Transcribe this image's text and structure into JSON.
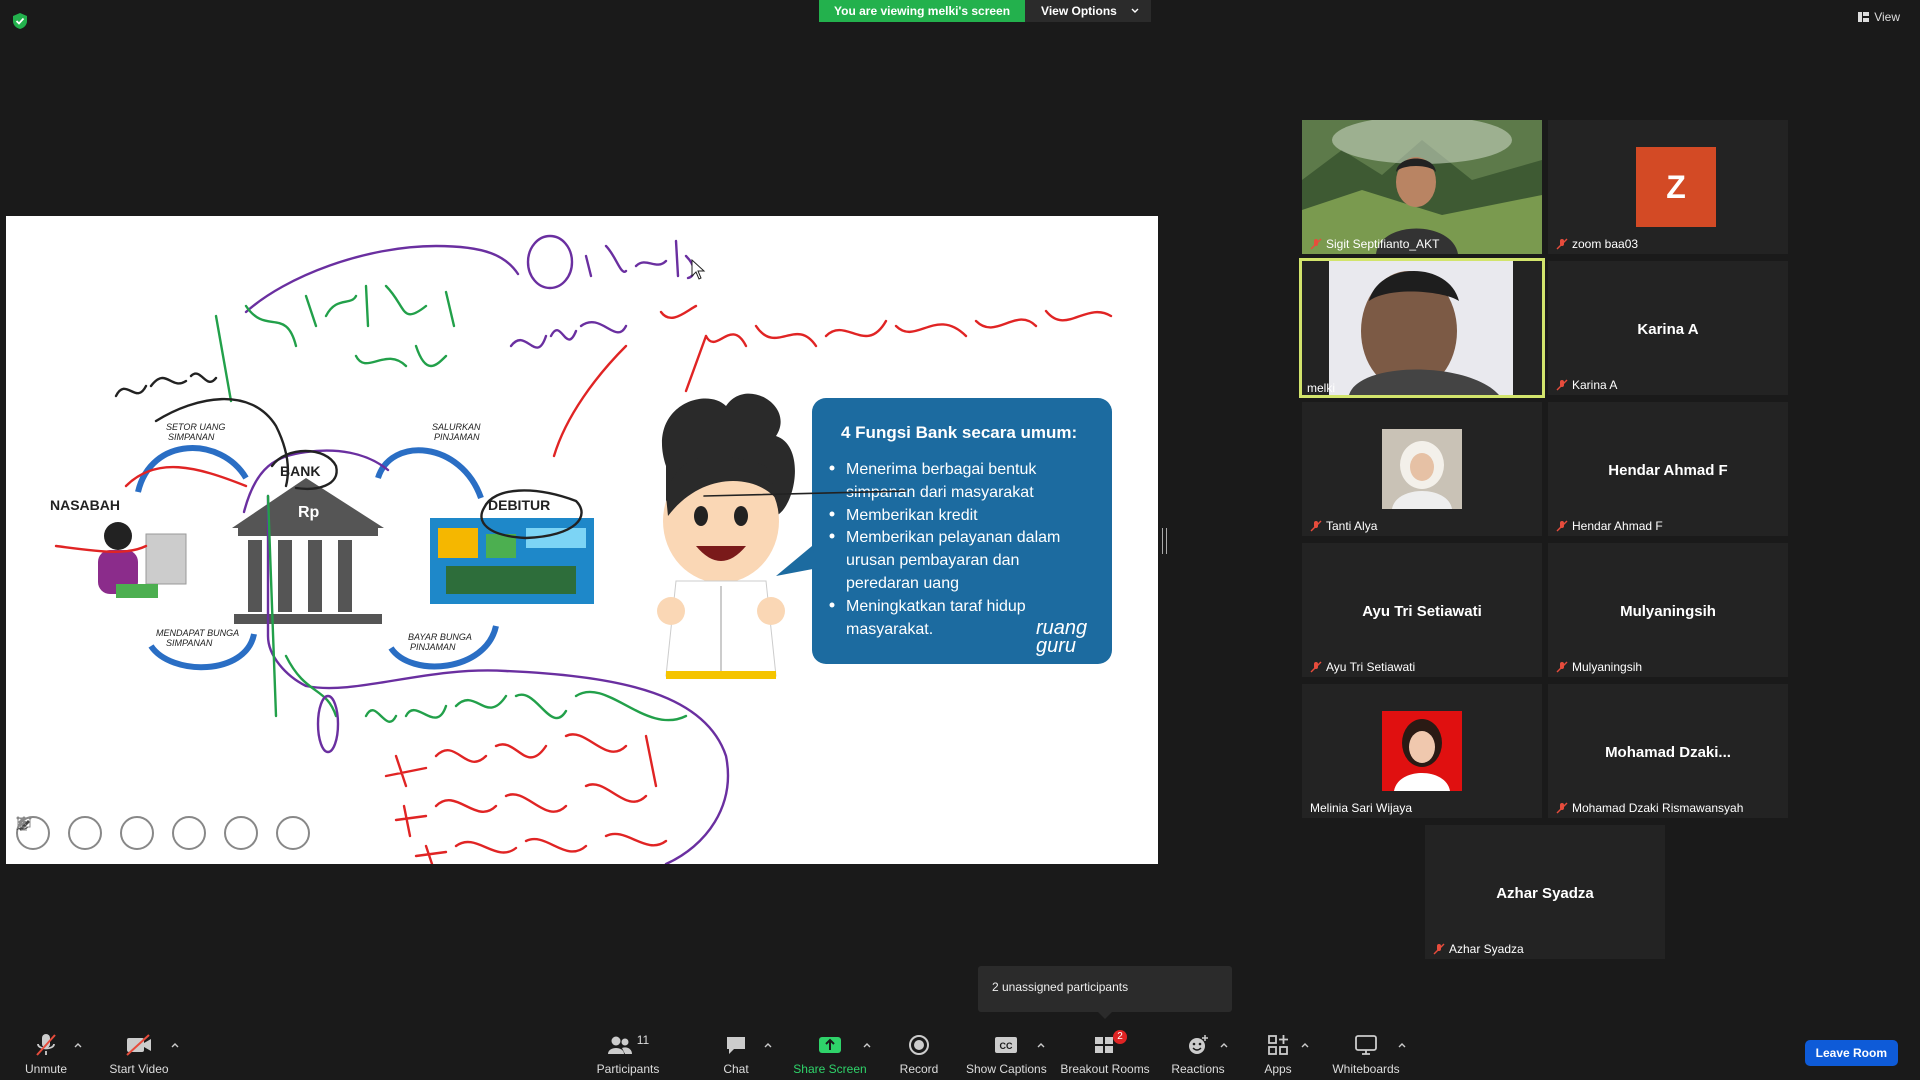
{
  "banner": {
    "viewing": "You are viewing melki's screen",
    "view_options": "View Options"
  },
  "view_button": "View",
  "slide": {
    "box_title": "4 Fungsi Bank secara umum:",
    "bullets": [
      "Menerima berbagai bentuk",
      "simpanan dari masyarakat",
      "Memberikan kredit",
      "Memberikan pelayanan dalam",
      "urusan pembayaran dan",
      "peredaran uang",
      "Meningkatkan taraf hidup",
      "masyarakat."
    ],
    "brand": [
      "ruang",
      "guru"
    ],
    "nasabah": "NASABAH",
    "bank": "BANK",
    "rp": "Rp",
    "debitur": "DEBITUR",
    "flow_setor": [
      "SETOR UANG",
      "SIMPANAN"
    ],
    "flow_salurkan": [
      "SALURKAN",
      "PINJAMAN"
    ],
    "flow_bunga_simpanan": [
      "MENDAPAT BUNGA",
      "SIMPANAN"
    ],
    "flow_bunga_pinjaman": [
      "BAYAR BUNGA",
      "PINJAMAN"
    ]
  },
  "participants": [
    {
      "name": "Sigit Septifianto_AKT",
      "muted": true
    },
    {
      "name": "zoom baa03",
      "muted": true,
      "avatar_letter": "Z"
    },
    {
      "name": "melki",
      "muted": false
    },
    {
      "name": "Karina A",
      "muted": true,
      "big": "Karina A"
    },
    {
      "name": "Tanti Alya",
      "muted": true
    },
    {
      "name": "Hendar Ahmad F",
      "muted": true,
      "big": "Hendar Ahmad F"
    },
    {
      "name": "Ayu Tri Setiawati",
      "muted": true,
      "big": "Ayu Tri Setiawati"
    },
    {
      "name": "Mulyaningsih",
      "muted": true,
      "big": "Mulyaningsih"
    },
    {
      "name": "Melinia Sari Wijaya",
      "muted": false
    },
    {
      "name": "Mohamad Dzaki Rismawansyah",
      "muted": true,
      "big": "Mohamad  Dzaki..."
    },
    {
      "name": "Azhar Syadza",
      "muted": true,
      "big": "Azhar Syadza"
    }
  ],
  "tooltip": "2 unassigned participants",
  "toolbar": {
    "unmute": "Unmute",
    "start_video": "Start Video",
    "participants": "Participants",
    "participants_count": "11",
    "chat": "Chat",
    "share_screen": "Share Screen",
    "record": "Record",
    "show_captions": "Show Captions",
    "breakout_rooms": "Breakout Rooms",
    "breakout_badge": "2",
    "reactions": "Reactions",
    "apps": "Apps",
    "whiteboards": "Whiteboards",
    "leave": "Leave Room"
  },
  "colors": {
    "accent_green": "#23b14d",
    "leave_blue": "#0e5bd8",
    "active_border": "#d2e46c",
    "z_avatar": "#d34a25"
  }
}
